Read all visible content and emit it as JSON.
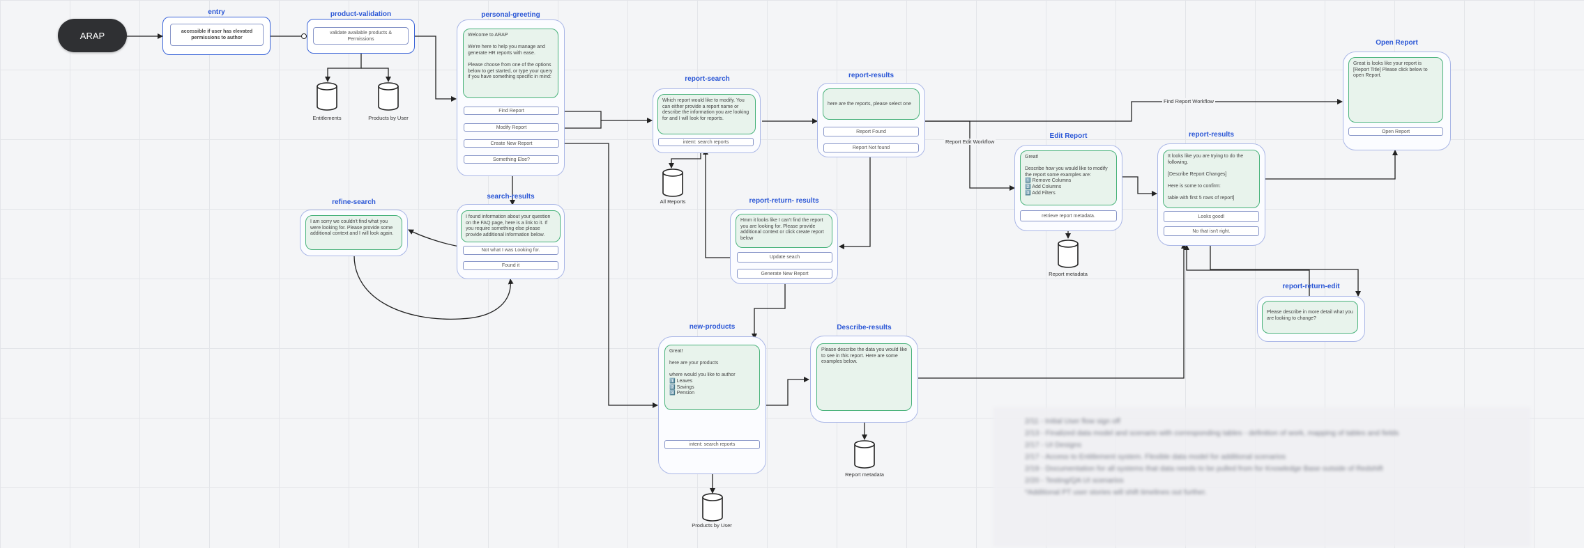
{
  "start": {
    "label": "ARAP"
  },
  "entry": {
    "title": "entry",
    "text": "accessible if user has elevated permissions to author"
  },
  "product_validation": {
    "title": "product-validation",
    "text": "validate available products & Permissions"
  },
  "databases": {
    "entitlements": "Entitlements",
    "products_by_user_1": "Products by User",
    "all_reports": "All Reports",
    "report_metadata_1": "Report metadata",
    "report_metadata_2": "Report metadata",
    "products_by_user_2": "Products by User"
  },
  "personal_greeting": {
    "title": "personal-greeting",
    "message": "Welcome to ARAP\n\nWe're here to help you manage and generate HR reports with ease.\n\nPlease choose from one of the options below to get started, or type your query if you have something specific in mind:",
    "options": [
      "Find Report",
      "Modify Report",
      "Create New Report",
      "Something Else?"
    ]
  },
  "search_results": {
    "title": "search-results",
    "message": "I found information about your question on the FAQ page, here is a link to it. If you require something else please provide additional information below.",
    "options": [
      "Not what I was Looking for.",
      "Found it"
    ]
  },
  "refine_search": {
    "title": "refine-search",
    "message": "I am sorry we couldn't find what you were looking for. Please provide some additional context and I will look again."
  },
  "report_search": {
    "title": "report-search",
    "message": "Which report would like to modify. You can either provide a report name or describe the information you are looking for and I will look for reports.",
    "options": [
      "intent: search reports"
    ]
  },
  "report_results": {
    "title": "report-results",
    "message": "here are the reports, please select one",
    "options": [
      "Report Found",
      "Report Not found"
    ]
  },
  "report_return_results": {
    "title": "report-return- results",
    "message": "Hmm it looks like I can't find the report you are looking for. Please provide additional context or click create report below",
    "options": [
      "Update seach",
      "Generate New Report"
    ]
  },
  "new_products": {
    "title": "new-products",
    "message": "Great!\n\nhere are your products\n\nwhere would you like to author\n1️⃣ Leaves\n2️⃣ Savings\n3️⃣ Pension",
    "options": [
      "intent: search reports"
    ]
  },
  "describe_results": {
    "title": "Describe-results",
    "message": "Please describe the data you would like to see in this report. Here are some examples below."
  },
  "edit_report": {
    "title": "Edit Report",
    "message": "Great!\n\nDescribe how you would like to modify the report some examples are:\n1️⃣ Remove Columns\n2️⃣ Add Columns\n3️⃣ Add Filters",
    "options": [
      "retrieve report metadata."
    ]
  },
  "report_results_2": {
    "title": "report-results",
    "message": "It looks like you are trying to do the following.\n\n[Describe Report Changes]\n\nHere is some to confirm:\n\ntable with first 5 rows of report]",
    "options": [
      "Looks good!",
      "No that isn't right."
    ]
  },
  "report_return_edit": {
    "title": "report-return-edit",
    "message": "Please describe in more detail what you are looking to change?"
  },
  "open_report": {
    "title": "Open Report",
    "message": "Great is looks like your report is [Report Title] Please click below to open Report.",
    "options": [
      "Open Report"
    ]
  },
  "edge_labels": {
    "find_report_workflow": "Find Report Workflow",
    "report_edit_workflow": "Report Edit Workflow"
  },
  "notes": [
    "2/11 - Initial User flow sign off",
    "2/13 - Finalized data model and scenario with corresponding tables - definition of work, mapping of tables and fields",
    "2/17 - UI Designs",
    "2/17 - Access to Entitlement system. Flexible data model for additional scenarios",
    "2/19 - Documentation for all systems that data needs to be pulled from for Knowledge Base outside of Redshift",
    "2/20 - Testing/QA UI scenarios",
    "*Additional PT user stories will shift timelines out further."
  ],
  "colors": {
    "accent": "#3a64d8",
    "title": "#2b57d6",
    "message_fill": "#e8f3ec",
    "message_border": "#48b27a",
    "start_fill": "#2f3033"
  }
}
